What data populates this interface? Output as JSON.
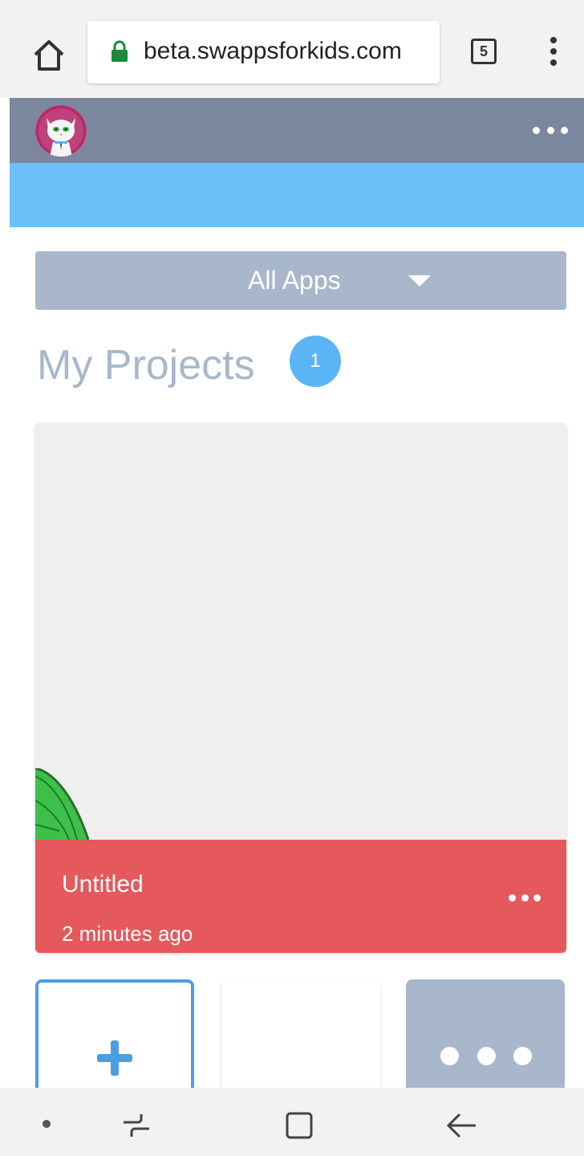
{
  "browser": {
    "url": "beta.swappsforkids.com",
    "tab_count": "5"
  },
  "filter": {
    "selected": "All Apps"
  },
  "page": {
    "title": "My Projects",
    "project_count": "1"
  },
  "projects": [
    {
      "name": "Untitled",
      "updated": "2 minutes ago"
    }
  ],
  "colors": {
    "header": "#7a879f",
    "accent_blue": "#6cc0f8",
    "card_footer": "#e5585b",
    "slate": "#a8b7cb"
  },
  "icons": [
    "home-icon",
    "lock-icon",
    "tabs-icon",
    "overflow-menu-icon",
    "avatar-cat",
    "chevron-down-icon",
    "plus-icon"
  ]
}
